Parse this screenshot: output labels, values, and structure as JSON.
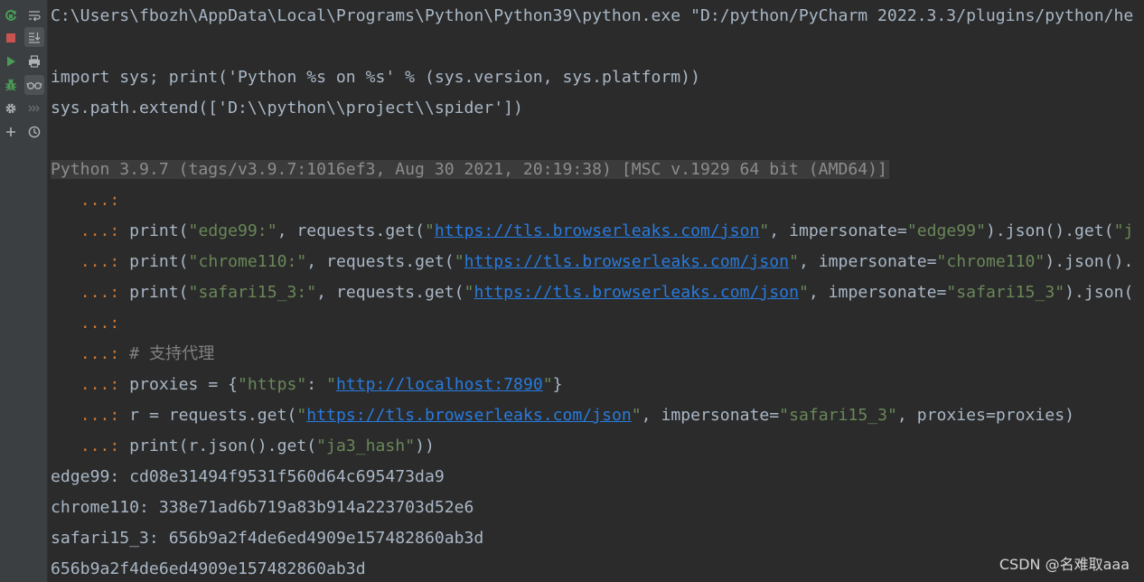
{
  "toolbar": {
    "left": [
      {
        "icon": "rerun-icon",
        "color": "#499c54"
      },
      {
        "icon": "stop-icon",
        "color": "#c75450"
      },
      {
        "icon": "run-icon",
        "color": "#499c54"
      },
      {
        "icon": "debug-icon",
        "color": "#499c54"
      },
      {
        "icon": "gear-icon",
        "color": "#afb1b3"
      },
      {
        "icon": "plus-icon",
        "color": "#afb1b3"
      }
    ],
    "right": [
      {
        "icon": "soft-wrap-icon",
        "active": false
      },
      {
        "icon": "scroll-to-end-icon",
        "active": true
      },
      {
        "icon": "print-icon",
        "active": false
      },
      {
        "icon": "show-variables-icon",
        "active": true
      },
      {
        "icon": "execute-selection-icon",
        "active": false
      },
      {
        "icon": "history-icon",
        "active": false
      }
    ]
  },
  "console": {
    "command_line": "C:\\Users\\fbozh\\AppData\\Local\\Programs\\Python\\Python39\\python.exe \"D:/python/PyCharm 2022.3.3/plugins/python/he",
    "init_line_1": "import sys; print('Python %s on %s' % (sys.version, sys.platform))",
    "init_line_2": "sys.path.extend(['D:\\\\python\\\\project\\\\spider'])",
    "banner": "Python 3.9.7 (tags/v3.9.7:1016ef3, Aug 30 2021, 20:19:38) [MSC v.1929 64 bit (AMD64)]",
    "prompt": "...:",
    "code": {
      "l1": {
        "a": "print(",
        "b": "\"edge99:\"",
        "c": ", requests.get(",
        "d": "\"",
        "e": "https://tls.browserleaks.com/json",
        "f": "\"",
        "g": ", impersonate=",
        "h": "\"edge99\"",
        "i": ").json().get(",
        "j": "\"j"
      },
      "l2": {
        "a": "print(",
        "b": "\"chrome110:\"",
        "c": ", requests.get(",
        "d": "\"",
        "e": "https://tls.browserleaks.com/json",
        "f": "\"",
        "g": ", impersonate=",
        "h": "\"chrome110\"",
        "i": ").json()."
      },
      "l3": {
        "a": "print(",
        "b": "\"safari15_3:\"",
        "c": ", requests.get(",
        "d": "\"",
        "e": "https://tls.browserleaks.com/json",
        "f": "\"",
        "g": ", impersonate=",
        "h": "\"safari15_3\"",
        "i": ").json("
      },
      "comment": "# 支持代理",
      "l4": {
        "a": "proxies = {",
        "b": "\"https\"",
        "c": ": ",
        "d": "\"",
        "e": "http://localhost:7890",
        "f": "\"",
        "g": "}"
      },
      "l5": {
        "a": "r = requests.get(",
        "b": "\"",
        "c": "https://tls.browserleaks.com/json",
        "d": "\"",
        "e": ", impersonate=",
        "f": "\"safari15_3\"",
        "g": ", proxies=proxies)"
      },
      "l6": {
        "a": "print(r.json().get(",
        "b": "\"ja3_hash\"",
        "c": "))"
      }
    },
    "output": [
      "edge99: cd08e31494f9531f560d64c695473da9",
      "chrome110: 338e71ad6b719a83b914a223703d52e6",
      "safari15_3: 656b9a2f4de6ed4909e157482860ab3d",
      "656b9a2f4de6ed4909e157482860ab3d"
    ]
  },
  "watermark": "CSDN @名难取aaa",
  "colors": {
    "background": "#2b2b2b",
    "toolbar": "#3c3f41",
    "text": "#a9b7c6",
    "string": "#6a8759",
    "prompt": "#cc7832",
    "link": "#287bde",
    "comment": "#808080"
  }
}
